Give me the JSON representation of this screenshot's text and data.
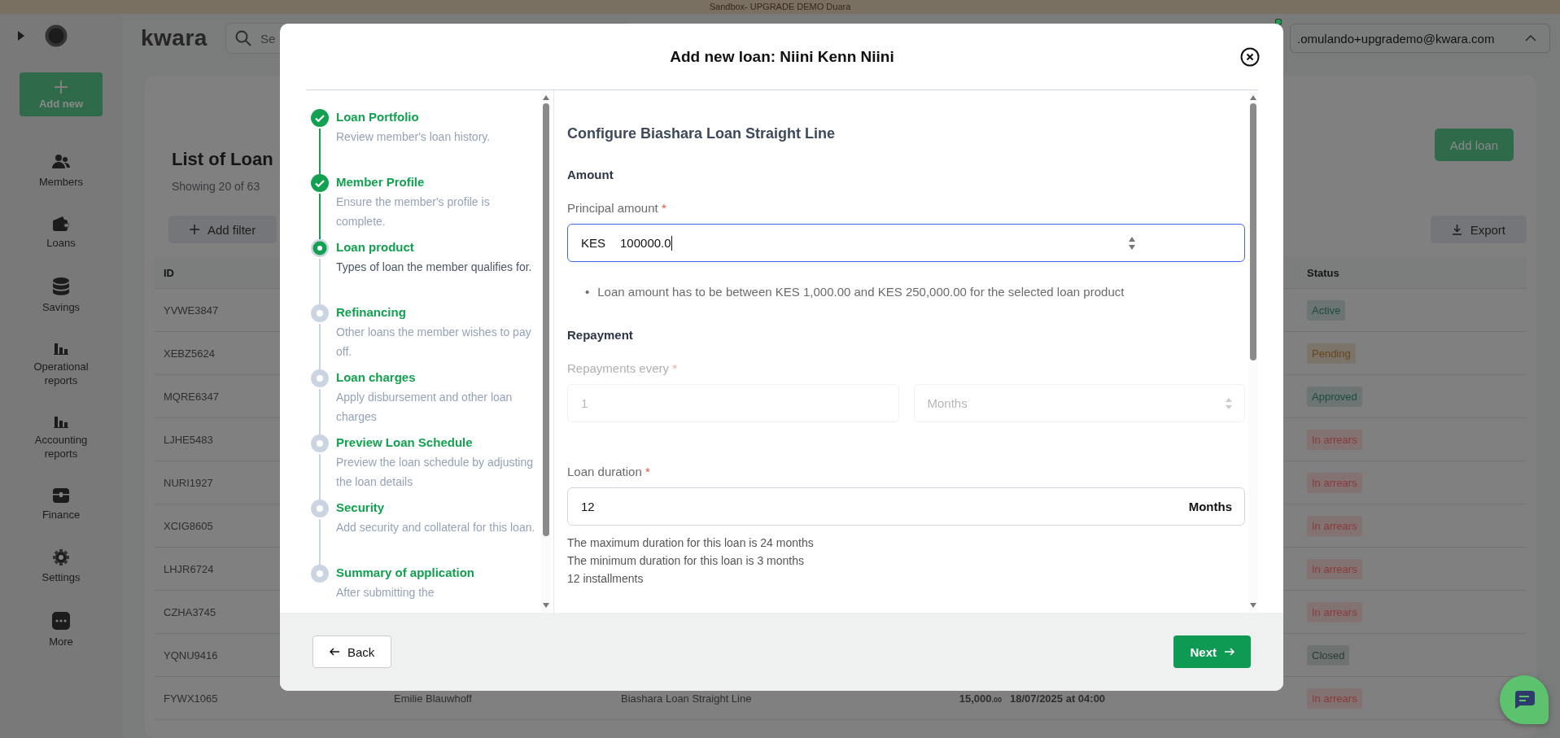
{
  "banner": "Sandbox- UPGRADE DEMO Duara",
  "top_bar": {
    "logo": "kwara",
    "search": {
      "placeholder": "Se"
    },
    "account_email": ".omulando+upgrademo@kwara.com"
  },
  "sidebar": {
    "add_new": "Add new",
    "items": [
      {
        "label": "Members",
        "kind": "members"
      },
      {
        "label": "Loans",
        "kind": "loans"
      },
      {
        "label": "Savings",
        "kind": "savings"
      },
      {
        "label": "Operational reports",
        "kind": "reports"
      },
      {
        "label": "Accounting reports",
        "kind": "reports"
      },
      {
        "label": "Finance",
        "kind": "finance"
      },
      {
        "label": "Settings",
        "kind": "settings"
      },
      {
        "label": "More",
        "kind": "more"
      }
    ]
  },
  "page": {
    "title": "List of Loan",
    "subtitle": "Showing 20 of 63",
    "add_loan": "Add loan",
    "add_filter": "Add filter",
    "export": "Export",
    "table": {
      "columns": [
        "ID",
        "Status"
      ],
      "rows": [
        {
          "id": "YVWE3847",
          "status": "Active",
          "color": "#1d4a40"
        },
        {
          "id": "XEBZ5624",
          "status": "Pending",
          "color": "#66461a"
        },
        {
          "id": "MQRE6347",
          "status": "Approved",
          "color": "#1d4a40"
        },
        {
          "id": "LJHE5483",
          "status": "In arrears",
          "color": "#8a3a3a"
        },
        {
          "id": "NURI1927",
          "status": "In arrears",
          "color": "#8a3a3a"
        },
        {
          "id": "XCIG8605",
          "status": "In arrears",
          "color": "#8a3a3a"
        },
        {
          "id": "LHJR6724",
          "status": "In arrears",
          "color": "#8a3a3a"
        },
        {
          "id": "CZHA3745",
          "status": "In arrears",
          "color": "#8a3a3a"
        },
        {
          "id": "YQNU9416",
          "status": "Closed",
          "color": "#2a3a38"
        },
        {
          "id": "FYWX1065",
          "name": "Emilie Blauwhoff",
          "product": "Biashara Loan Straight Line",
          "amount": "15,000.00",
          "date": "18/07/2025 at 04:00",
          "status": "In arrears",
          "color": "#8a3a3a"
        }
      ]
    }
  },
  "modal": {
    "title": "Add new loan: Niini Kenn Niini",
    "steps": [
      {
        "title": "Loan Portfolio",
        "description": "Review member's loan history.",
        "done": true,
        "selected": false
      },
      {
        "title": "Member Profile",
        "description": "Ensure the member's profile is complete.",
        "done": true,
        "selected": false
      },
      {
        "title": "Loan product",
        "description": "Types of loan the member qualifies for.",
        "done": false,
        "selected": true
      },
      {
        "title": "Refinancing",
        "description": "Other loans the member wishes to pay off.",
        "done": false,
        "selected": false
      },
      {
        "title": "Loan charges",
        "description": "Apply disbursement and other loan charges",
        "done": false,
        "selected": false
      },
      {
        "title": "Preview Loan Schedule",
        "description": "Preview the loan schedule by adjusting the loan details",
        "done": false,
        "selected": false
      },
      {
        "title": "Security",
        "description": "Add security and collateral for this loan.",
        "done": false,
        "selected": false
      },
      {
        "title": "Summary of application",
        "description": "After submitting the",
        "done": false,
        "selected": false
      }
    ],
    "form": {
      "heading": "Configure Biashara Loan Straight Line",
      "amount_section": "Amount",
      "principal": {
        "label": "Principal amount",
        "required_mark": "*",
        "currency": "KES",
        "value": "100000.0",
        "focused": true
      },
      "hint_bullet": "•",
      "hint": "Loan amount has to be between KES 1,000.00 and KES 250,000.00 for the selected loan product",
      "repayment_section": "Repayment",
      "repayments_every": {
        "label": "Repayments every",
        "required_mark": "*",
        "value": "1",
        "unit": "Months",
        "disabled": true
      },
      "duration": {
        "label": "Loan duration",
        "required_mark": "*",
        "value": "12",
        "unit": "Months"
      },
      "notes": [
        "The maximum duration for this loan is 24 months",
        "The minimum duration for this loan is 3 months",
        "12 installments"
      ]
    },
    "back": "Back",
    "next": "Next"
  }
}
